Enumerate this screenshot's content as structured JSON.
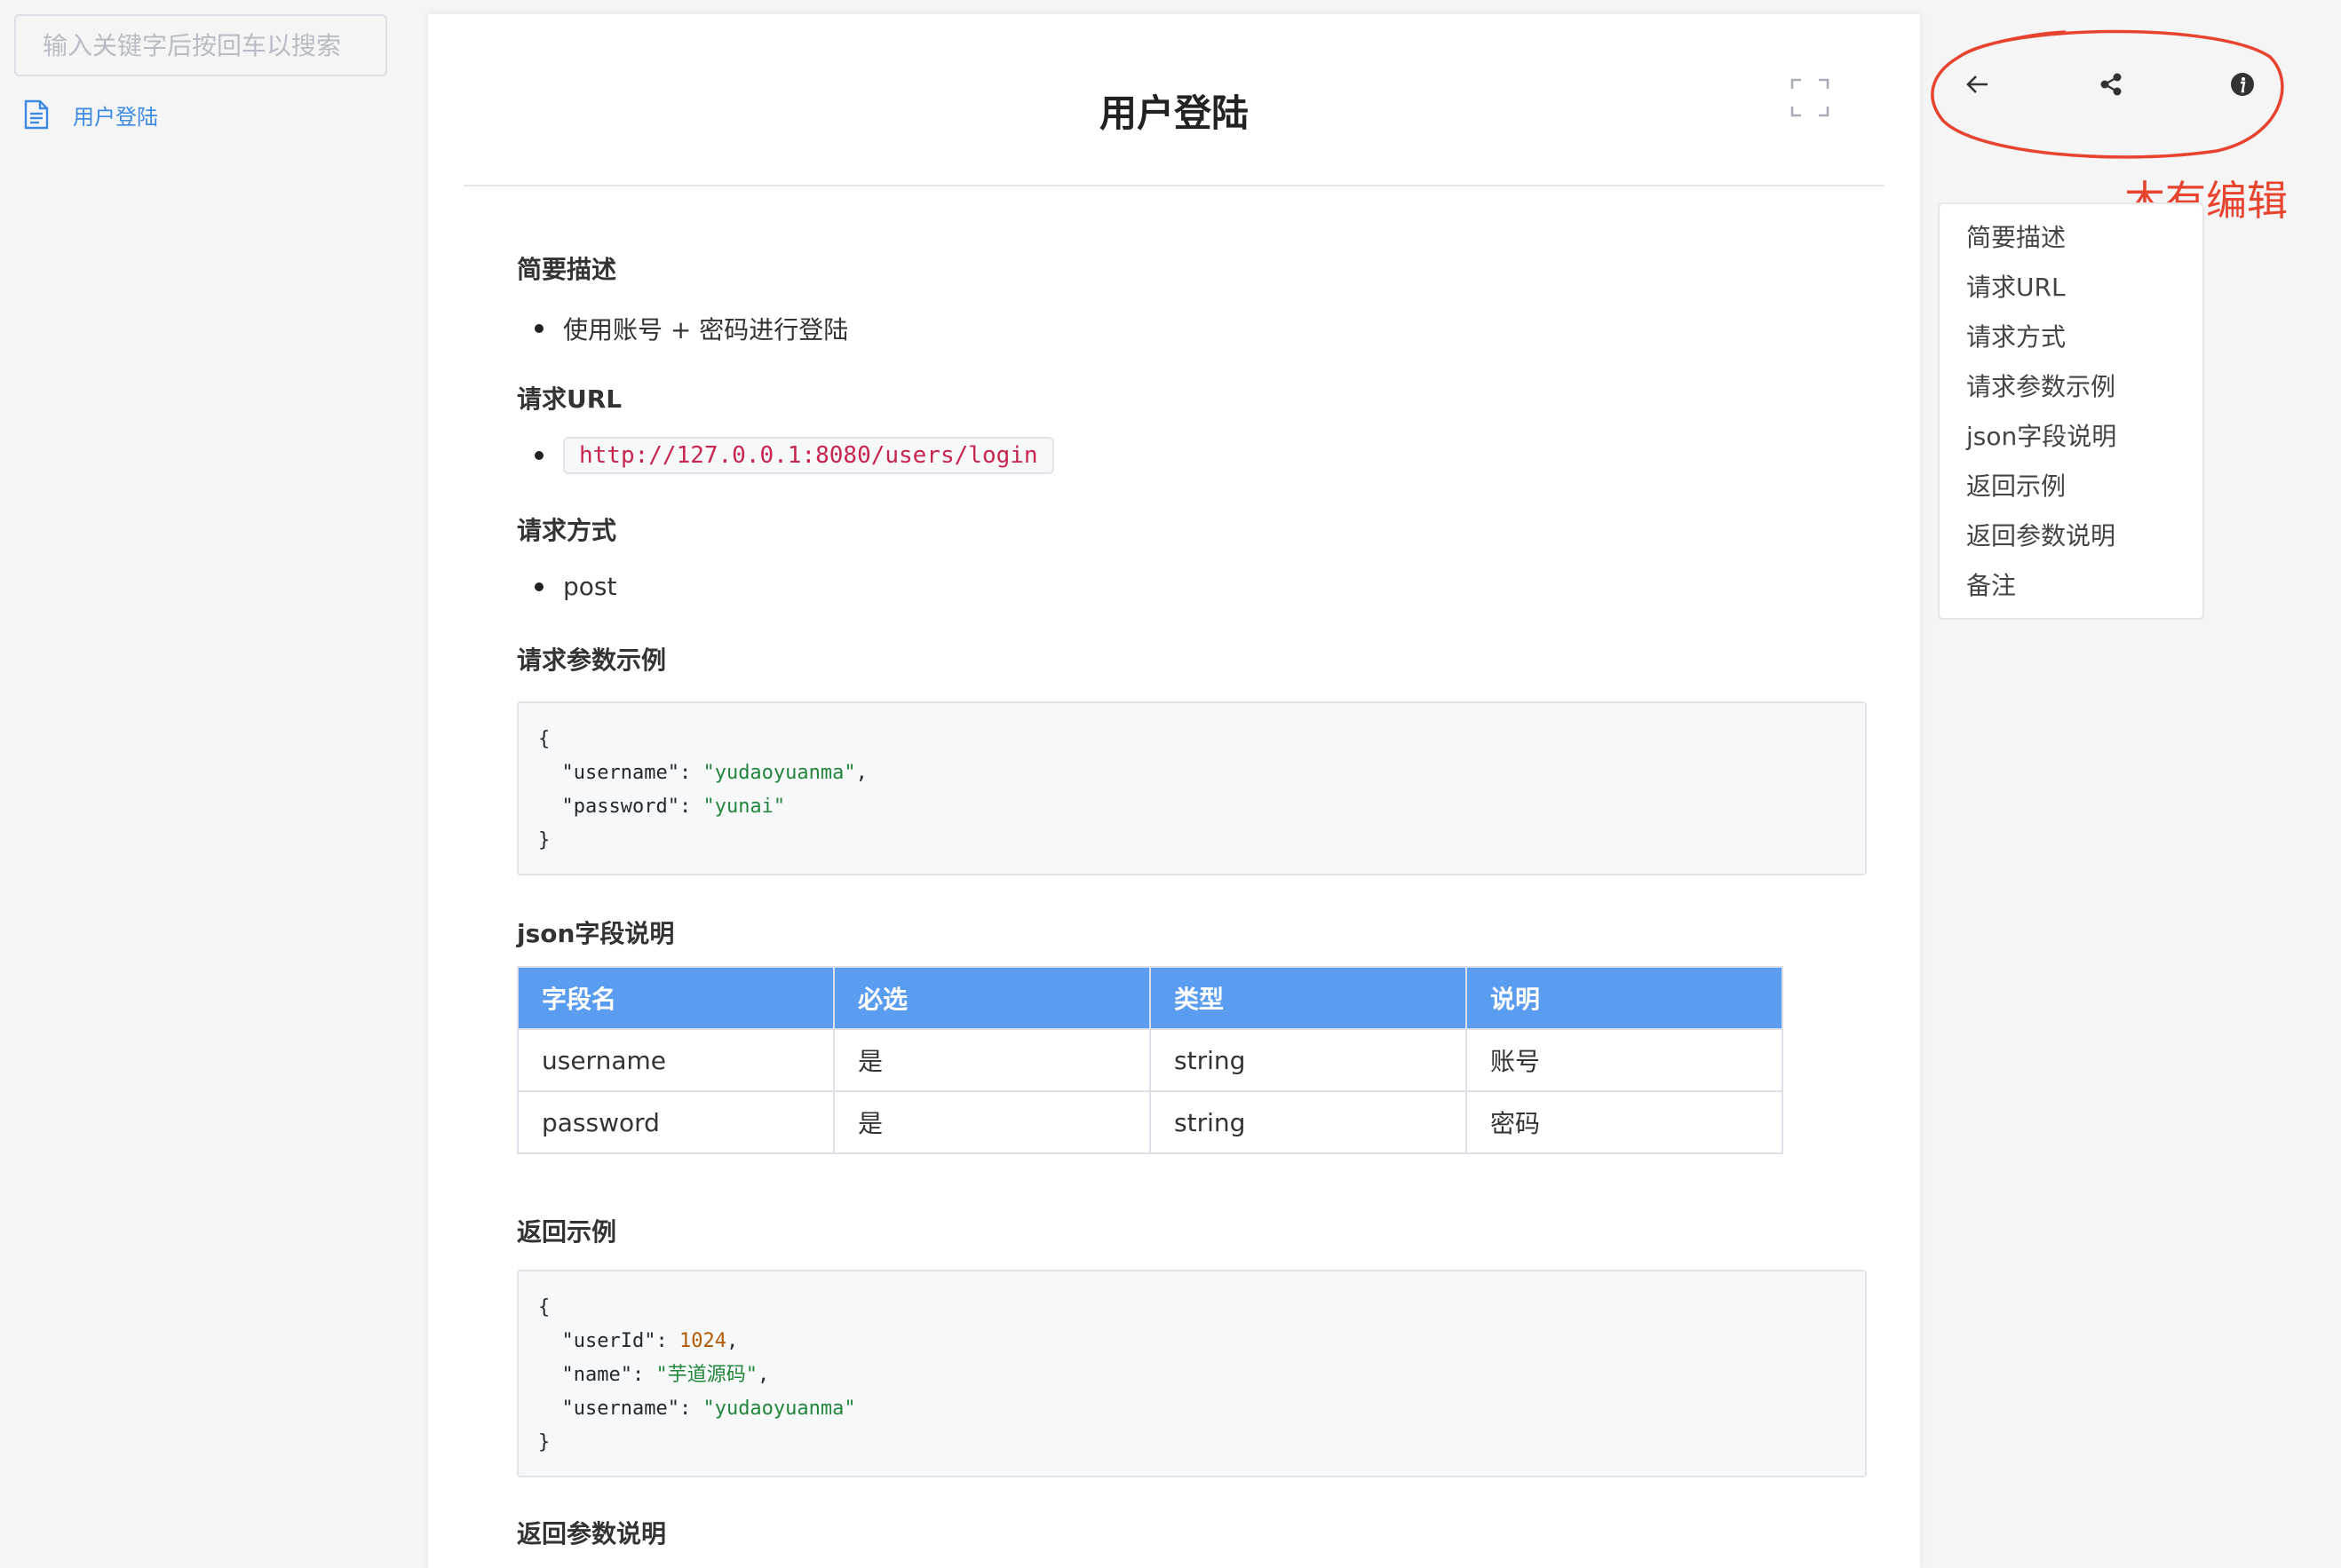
{
  "sidebar": {
    "search_placeholder": "输入关键字后按回车以搜索",
    "items": [
      {
        "label": "用户登陆",
        "icon": "document-icon"
      }
    ]
  },
  "page": {
    "title": "用户登陆"
  },
  "sections": {
    "desc": {
      "heading": "简要描述",
      "bullet": "使用账号 + 密码进行登陆"
    },
    "url": {
      "heading": "请求URL",
      "value": "http://127.0.0.1:8080/users/login"
    },
    "method": {
      "heading": "请求方式",
      "value": "post"
    },
    "request_example": {
      "heading": "请求参数示例",
      "lines": [
        {
          "open": "{"
        },
        {
          "key": "\"username\"",
          "value": "\"yudaoyuanma\"",
          "trail": ","
        },
        {
          "key": "\"password\"",
          "value": "\"yunai\"",
          "trail": ""
        },
        {
          "close": "}"
        }
      ]
    },
    "json_fields": {
      "heading": "json字段说明",
      "headers": [
        "字段名",
        "必选",
        "类型",
        "说明"
      ],
      "rows": [
        [
          "username",
          "是",
          "string",
          "账号"
        ],
        [
          "password",
          "是",
          "string",
          "密码"
        ]
      ]
    },
    "response_example": {
      "heading": "返回示例",
      "lines": [
        {
          "open": "{"
        },
        {
          "key": "\"userId\"",
          "value": "1024",
          "trail": ","
        },
        {
          "key": "\"name\"",
          "value": "\"芋道源码\"",
          "trail": ","
        },
        {
          "key": "\"username\"",
          "value": "\"yudaoyuanma\"",
          "trail": ""
        },
        {
          "close": "}"
        }
      ]
    },
    "response_params": {
      "heading": "返回参数说明"
    }
  },
  "toolbar": {
    "icons": [
      "back-arrow-icon",
      "share-icon",
      "info-icon"
    ]
  },
  "annotation": {
    "text": "木有编辑",
    "color": "#e8432f"
  },
  "toc": {
    "items": [
      "简要描述",
      "请求URL",
      "请求方式",
      "请求参数示例",
      "json字段说明",
      "返回示例",
      "返回参数说明",
      "备注"
    ]
  },
  "colors": {
    "accent": "#3c8ae6",
    "table_header": "#5a9cf0",
    "url_code": "#c7254e"
  }
}
